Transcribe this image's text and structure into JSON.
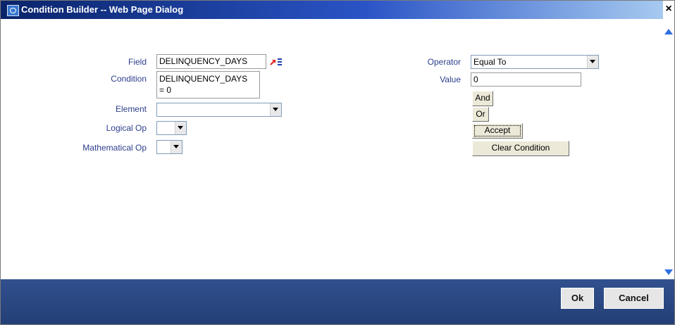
{
  "window": {
    "title": "Condition Builder -- Web Page Dialog",
    "close_glyph": "×"
  },
  "form": {
    "field": {
      "label": "Field",
      "value": "DELINQUENCY_DAYS"
    },
    "condition": {
      "label": "Condition",
      "value": "DELINQUENCY_DAYS\n= 0"
    },
    "element": {
      "label": "Element",
      "value": ""
    },
    "logical_op": {
      "label": "Logical Op",
      "value": ""
    },
    "mathematical_op": {
      "label": "Mathematical Op",
      "value": ""
    },
    "operator": {
      "label": "Operator",
      "value": "Equal To"
    },
    "value": {
      "label": "Value",
      "value": "0"
    }
  },
  "buttons": {
    "and": "And",
    "or": "Or",
    "accept": "Accept",
    "clear_condition": "Clear Condition"
  },
  "footer": {
    "ok": "Ok",
    "cancel": "Cancel"
  },
  "icons": [
    "ie-dialog-icon",
    "close-icon",
    "list-of-values-icon",
    "chevron-down-icon",
    "scroll-up-icon",
    "scroll-down-icon"
  ],
  "colors": {
    "label": "#2c3e8c",
    "footer": "#2a4680",
    "title_bar": "#0a246a"
  }
}
